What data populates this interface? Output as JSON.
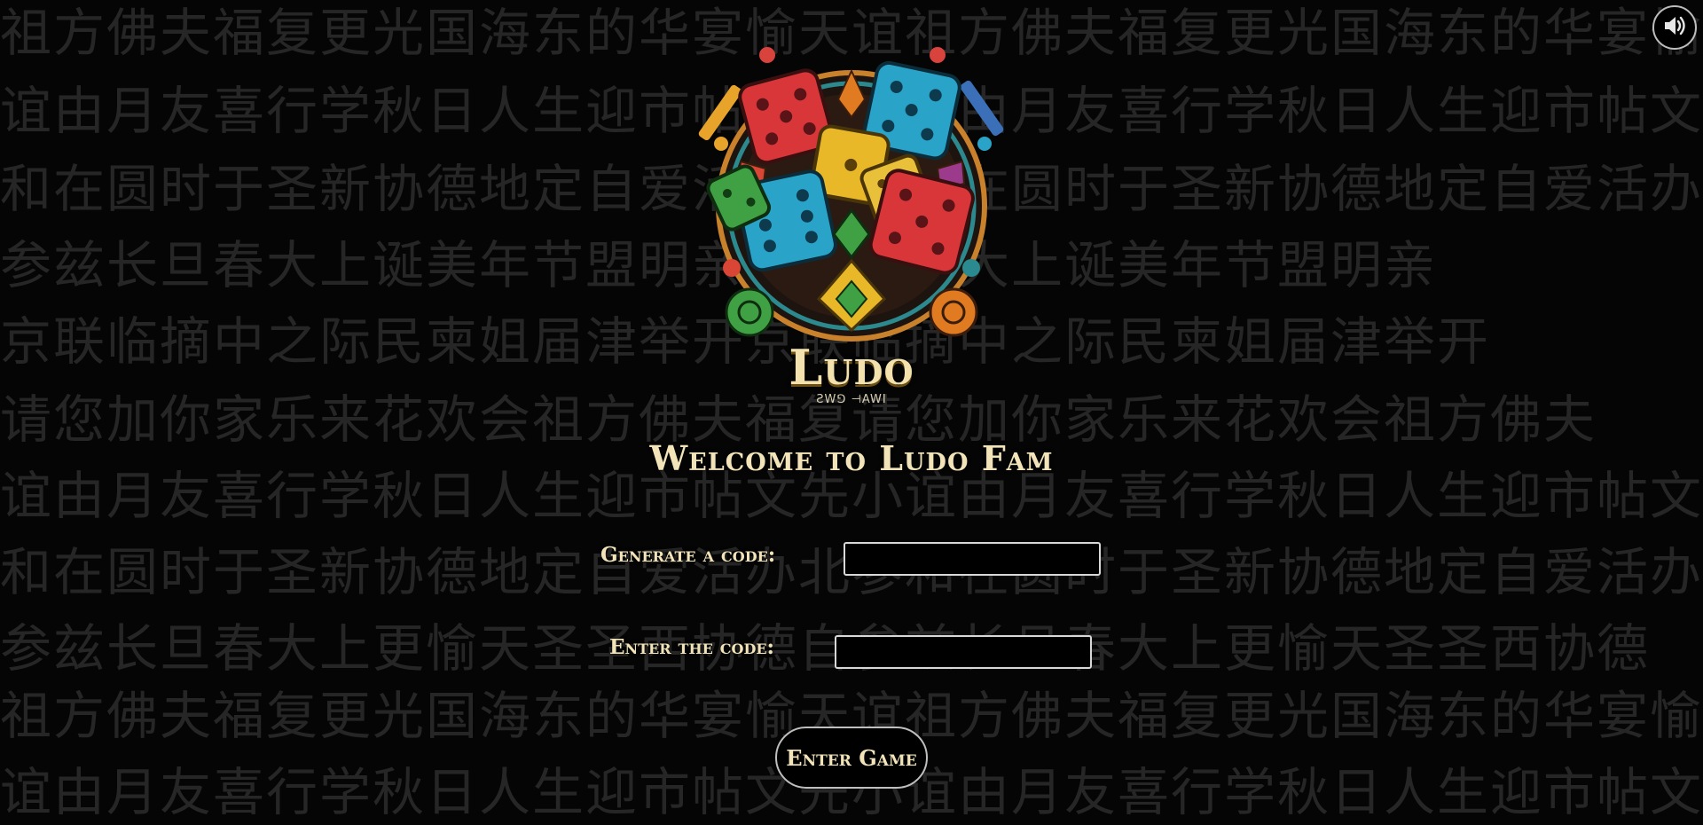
{
  "background_rows": [
    "祖方佛夫福复更光国海东的华宴愉天谊祖方佛夫福复更光国海东的华宴愉",
    "谊由月友喜行学秋日人生迎市帖文先小谊由月友喜行学秋日人生迎市帖文",
    "和在圆时于圣新协德地定自爱活办北参和在圆时于圣新协德地定自爱活办",
    "参兹长旦春大上诞美年节盟明亲兹长旦春大上诞美年节盟明亲",
    "京联临摘中之际民柬姐届津举开京联临摘中之际民柬姐届津举开",
    "请您加你家乐来花欢会祖方佛夫福复请您加你家乐来花欢会祖方佛夫",
    "谊由月友喜行学秋日人生迎市帖文先小谊由月友喜行学秋日人生迎市帖文",
    "和在圆时于圣新协德地定自爱活办北参和在圆时于圣新协德地定自爱活办",
    "参兹长旦春大上更愉天圣圣西协德自参兹长旦春大上更愉天圣圣西协德",
    "祖方佛夫福复更光国海东的华宴愉天谊祖方佛夫福复更光国海东的华宴愉",
    "谊由月友喜行学秋日人生迎市帖文先小谊由月友喜行学秋日人生迎市帖文"
  ],
  "sound_button": {
    "icon": "speaker-icon"
  },
  "logo": {
    "title": "Ludo",
    "subtitle": "ƧW⅁ ⊣AWI"
  },
  "welcome_title": "Welcome to Ludo Fam",
  "generate": {
    "label": "Generate a code:",
    "value": ""
  },
  "enter_code": {
    "label": "Enter the code:",
    "value": ""
  },
  "enter_button": {
    "label": "Enter Game"
  },
  "colors": {
    "gold_text": "#f2e4b8",
    "background": "#050505",
    "bg_glyph": "#262626",
    "die_red": "#d9363a",
    "die_blue": "#2aa3c9",
    "die_yellow": "#e8b829",
    "die_green": "#3fa143"
  }
}
